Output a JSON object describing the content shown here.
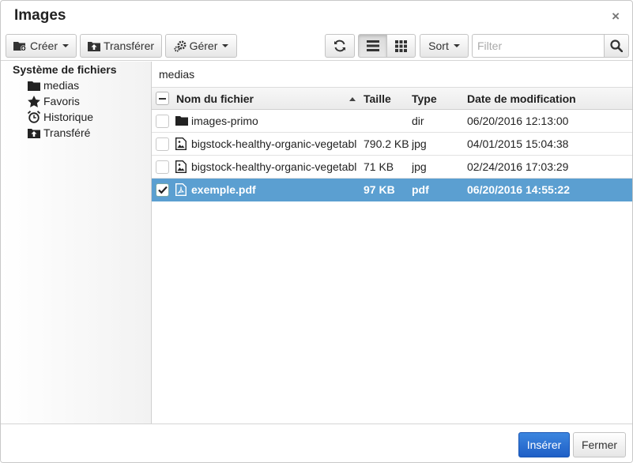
{
  "dialog": {
    "title": "Images",
    "close_glyph": "×"
  },
  "toolbar": {
    "create_label": "Créer",
    "upload_label": "Transférer",
    "manage_label": "Gérer",
    "sort_label": "Sort",
    "filter_placeholder": "Filter",
    "icons": [
      "folder-plus-icon",
      "upload-icon",
      "gears-icon",
      "refresh-icon",
      "list-view-icon",
      "grid-view-icon",
      "search-icon"
    ]
  },
  "sidebar": {
    "root_label": "Système de fichiers",
    "items": [
      {
        "label": "medias",
        "icon": "folder-icon"
      },
      {
        "label": "Favoris",
        "icon": "star-icon"
      },
      {
        "label": "Historique",
        "icon": "alarm-clock-icon"
      },
      {
        "label": "Transféré",
        "icon": "upload-icon"
      }
    ]
  },
  "main": {
    "path": "medias",
    "columns": {
      "name": "Nom du fichier",
      "size": "Taille",
      "type": "Type",
      "date": "Date de modification"
    },
    "rows": [
      {
        "name": "images-primo",
        "size": "",
        "type": "dir",
        "date": "06/20/2016 12:13:00",
        "icon": "folder-icon",
        "selected": false
      },
      {
        "name": "bigstock-healthy-organic-vegetabl",
        "size": "790.2 KB",
        "type": "jpg",
        "date": "04/01/2015 15:04:38",
        "icon": "image-file-icon",
        "selected": false
      },
      {
        "name": "bigstock-healthy-organic-vegetabl",
        "size": "71 KB",
        "type": "jpg",
        "date": "02/24/2016 17:03:29",
        "icon": "image-file-icon",
        "selected": false
      },
      {
        "name": "exemple.pdf",
        "size": "97 KB",
        "type": "pdf",
        "date": "06/20/2016 14:55:22",
        "icon": "pdf-file-icon",
        "selected": true
      }
    ]
  },
  "footer": {
    "insert_label": "Insérer",
    "close_label": "Fermer"
  },
  "colors": {
    "selected_row": "#5b9fd1",
    "primary_button": "#2a6fd6"
  }
}
